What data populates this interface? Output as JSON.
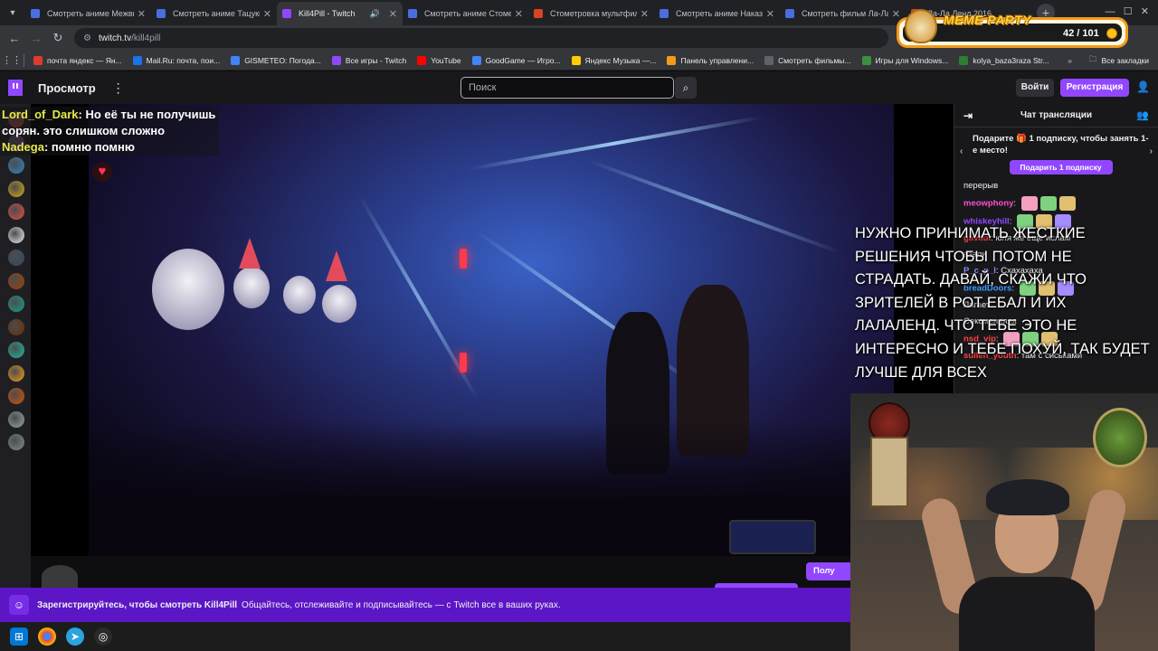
{
  "browser": {
    "tabs": [
      {
        "title": "Смотреть аниме Межвид",
        "color": "#4a6ee0",
        "active": false
      },
      {
        "title": "Смотреть аниме Тацуки",
        "color": "#4a6ee0",
        "active": false
      },
      {
        "title": "Kill4Pill - Twitch",
        "color": "#9147ff",
        "active": true
      },
      {
        "title": "Смотреть аниме Стометр",
        "color": "#4a6ee0",
        "active": false
      },
      {
        "title": "Стометровка мультфиль",
        "color": "#d6451f",
        "active": false
      },
      {
        "title": "Смотреть аниме Наказан",
        "color": "#4a6ee0",
        "active": false
      },
      {
        "title": "Смотреть фильм Ла-Ла Л",
        "color": "#4a6ee0",
        "active": false
      },
      {
        "title": "Ла-Ла Ленд 2016",
        "color": "#d6451f",
        "active": false
      }
    ],
    "url_host": "twitch.tv",
    "url_path": "/kill4pill",
    "bookmarks": [
      {
        "label": "почта яндекс — Ян...",
        "color": "#e03a2e"
      },
      {
        "label": "Mail.Ru: почта, пои...",
        "color": "#1a73e8"
      },
      {
        "label": "GISMETEO: Погода...",
        "color": "#4285f4"
      },
      {
        "label": "Все игры - Twitch",
        "color": "#9147ff"
      },
      {
        "label": "YouTube",
        "color": "#ff0000"
      },
      {
        "label": "GoodGame — Игро...",
        "color": "#4285f4"
      },
      {
        "label": "Яндекс Музыка —...",
        "color": "#ffcc00"
      },
      {
        "label": "Панель управлени...",
        "color": "#f29b1a"
      },
      {
        "label": "Смотреть фильмы...",
        "color": "#5f6368"
      },
      {
        "label": "Игры для Windows...",
        "color": "#3c8f3c"
      },
      {
        "label": "kolya_baza3raza Str...",
        "color": "#2e7d32"
      }
    ],
    "all_bookmarks": "Все закладки"
  },
  "twitch": {
    "browse": "Просмотр",
    "search_placeholder": "Поиск",
    "login": "Войти",
    "signup": "Регистрация",
    "chat_title": "Чат трансляции",
    "gift_text": "Подарите 🎁 1 подписку, чтобы занять 1-е место!",
    "gift_button": "Подарить 1 подписку",
    "subscribe_partial": "Полу",
    "banner_bold": "Зарегистрируйтесь, чтобы смотреть Kill4Pill",
    "banner_text": "Общайтесь, отслеживайте и подписывайтесь — с Twitch все в ваших руках."
  },
  "overlay_chat": [
    {
      "user": "Lord_of_Dark",
      "text": "Но её ты не получишь"
    },
    {
      "user": "",
      "text": "сорян. это слишком сложно"
    },
    {
      "user": "Nadega",
      "text": "помню помню"
    }
  ],
  "chat_messages": [
    {
      "user": "",
      "text": "перерыв",
      "color": "#efeff1"
    },
    {
      "user": "meowphony",
      "text": "",
      "color": "#ff4fd0"
    },
    {
      "user": "whiskeyhill",
      "text": "",
      "color": "#9147ff"
    },
    {
      "user": "gavaoi",
      "text": "юля же еще ислам",
      "color": "#ff4040"
    },
    {
      "user": "",
      "text": "азали",
      "color": "#efeff1"
    },
    {
      "user": "P_c_p_l",
      "text": "Схахахаха",
      "color": "#8a8aff"
    },
    {
      "user": "breadDoors",
      "text": "",
      "color": "#3a9cff"
    },
    {
      "user": "",
      "text": "Лагает",
      "color": "#efeff1"
    },
    {
      "user": "",
      "text": "Сексменяяяя",
      "color": "#efeff1"
    },
    {
      "user": "nsd_vip",
      "text": "",
      "color": "#ff4040"
    },
    {
      "user": "sullen_youth",
      "text": "там с сиськами",
      "color": "#ff4040"
    }
  ],
  "caption": "НУЖНО ПРИНИМАТЬ ЖЕСТКИЕ РЕШЕНИЯ ЧТОБЫ ПОТОМ НЕ СТРАДАТЬ. ДАВАЙ, СКАЖИ ЧТО ЗРИТЕЛЕЙ В РОТ ЕБАЛ И ИХ ЛАЛАЛЕНД. ЧТО ТЕБЕ ЭТО НЕ ИНТЕРЕСНО И ТЕБЕ ПОХУЙ, ТАК БУДЕТ ЛУЧШЕ ДЛЯ ВСЕХ",
  "meme_widget": {
    "title": "MEME PARTY",
    "count": "42 / 101"
  }
}
